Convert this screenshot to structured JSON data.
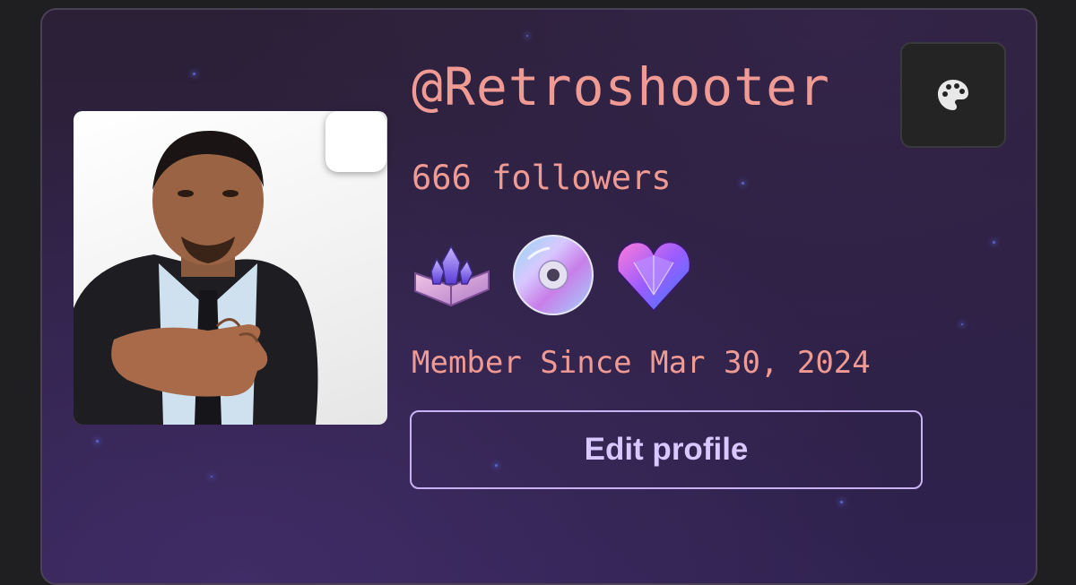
{
  "profile": {
    "username": "@Retroshooter",
    "followers": "666 followers",
    "member_since": "Member Since Mar 30, 2024",
    "edit_label": "Edit profile"
  },
  "icons": {
    "theme": "palette-icon",
    "badges": [
      "spellbook-crystal-badge",
      "cd-disc-badge",
      "gem-heart-badge"
    ]
  },
  "colors": {
    "text_accent": "#f09a94",
    "button_border": "#c8b2f2",
    "button_text": "#d9c7ff",
    "card_bg": "#2d2142"
  }
}
